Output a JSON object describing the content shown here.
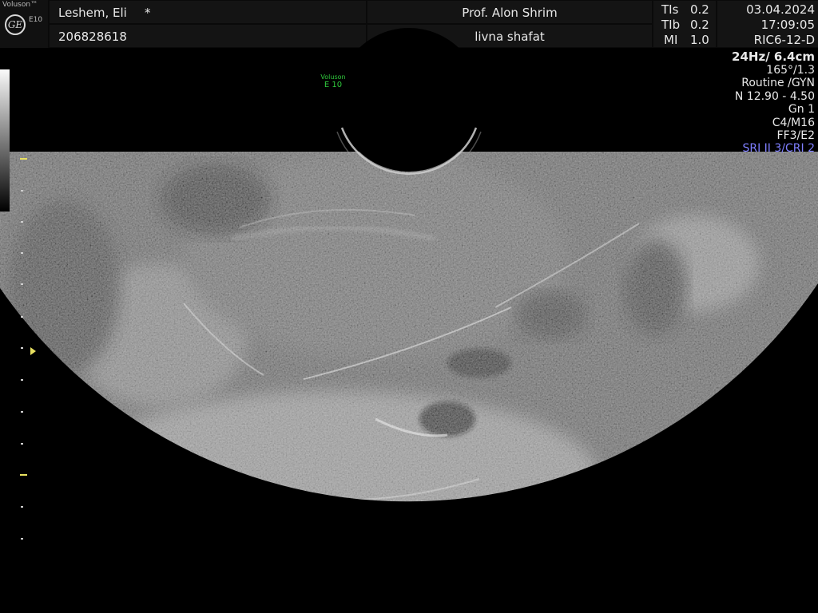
{
  "header": {
    "brand": "Voluson™",
    "model": "E10",
    "ge_logo": "GE",
    "patient_name": "Leshem, Eli",
    "patient_flag": "*",
    "patient_id": "206828618",
    "physician": "Prof. Alon Shrim",
    "operator": "livna shafat",
    "tis_label": "TIs",
    "tis_value": "0.2",
    "tib_label": "TIb",
    "tib_value": "0.2",
    "mi_label": "MI",
    "mi_value": "1.0",
    "date": "03.04.2024",
    "time": "17:09:05",
    "probe": "RIC6-12-D"
  },
  "params": {
    "frame_depth": "24Hz/ 6.4cm",
    "angle": "165°/1.3",
    "preset": "Routine /GYN",
    "freq": "N 12.90 - 4.50",
    "gain": "Gn  1",
    "map": "C4/M16",
    "filter": "FF3/E2",
    "sri": "SRI II 3/CRI 2",
    "sri_color": "#7f7fff"
  },
  "image_mark": {
    "line1": "Voluson",
    "line2": "E 10",
    "color": "#2fc83c"
  }
}
